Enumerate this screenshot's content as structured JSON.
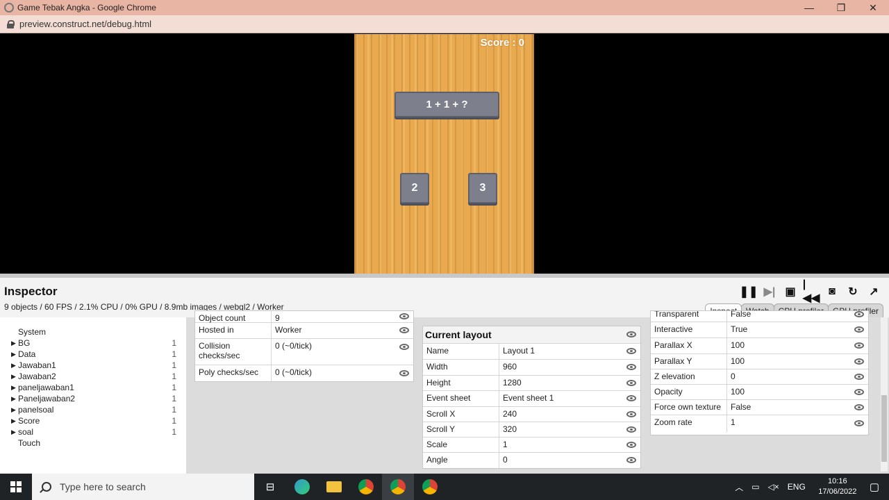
{
  "window": {
    "title": "Game Tebak Angka - Google Chrome",
    "url": "preview.construct.net/debug.html",
    "minimize": "—",
    "maximize": "❐",
    "close": "✕"
  },
  "game": {
    "score": "Score : 0",
    "question": "1 + 1 + ?",
    "answer1": "2",
    "answer2": "3"
  },
  "inspector": {
    "title": "Inspector",
    "stats": "9 objects / 60 FPS / 2.1% CPU / 0% GPU / 8.9mb images / webgl2 / Worker",
    "tabs": [
      "Inspect",
      "Watch",
      "CPU profiler",
      "GPU profiler"
    ],
    "tree": [
      {
        "label": "System",
        "count": ""
      },
      {
        "label": "BG",
        "count": "1"
      },
      {
        "label": "Data",
        "count": "1"
      },
      {
        "label": "Jawaban1",
        "count": "1"
      },
      {
        "label": "Jawaban2",
        "count": "1"
      },
      {
        "label": "paneljawaban1",
        "count": "1"
      },
      {
        "label": "Paneljawaban2",
        "count": "1"
      },
      {
        "label": "panelsoal",
        "count": "1"
      },
      {
        "label": "Score",
        "count": "1"
      },
      {
        "label": "soal",
        "count": "1"
      },
      {
        "label": "Touch",
        "count": ""
      }
    ],
    "system_table": [
      {
        "name": "Object count",
        "value": "9"
      },
      {
        "name": "Hosted in",
        "value": "Worker"
      },
      {
        "name": "Collision checks/sec",
        "value": "0 (~0/tick)"
      },
      {
        "name": "Poly checks/sec",
        "value": "0 (~0/tick)"
      }
    ],
    "layout_title": "Current layout",
    "layout_table": [
      {
        "name": "Name",
        "value": "Layout 1"
      },
      {
        "name": "Width",
        "value": "960"
      },
      {
        "name": "Height",
        "value": "1280"
      },
      {
        "name": "Event sheet",
        "value": "Event sheet 1"
      },
      {
        "name": "Scroll X",
        "value": "240"
      },
      {
        "name": "Scroll Y",
        "value": "320"
      },
      {
        "name": "Scale",
        "value": "1"
      },
      {
        "name": "Angle",
        "value": "0"
      }
    ],
    "layer_table": [
      {
        "name": "Transparent",
        "value": "False"
      },
      {
        "name": "Interactive",
        "value": "True"
      },
      {
        "name": "Parallax X",
        "value": "100"
      },
      {
        "name": "Parallax Y",
        "value": "100"
      },
      {
        "name": "Z elevation",
        "value": "0"
      },
      {
        "name": "Opacity",
        "value": "100"
      },
      {
        "name": "Force own texture",
        "value": "False"
      },
      {
        "name": "Zoom rate",
        "value": "1"
      }
    ]
  },
  "taskbar": {
    "search_placeholder": "Type here to search",
    "lang": "ENG",
    "time": "10:16",
    "date": "17/06/2022"
  }
}
